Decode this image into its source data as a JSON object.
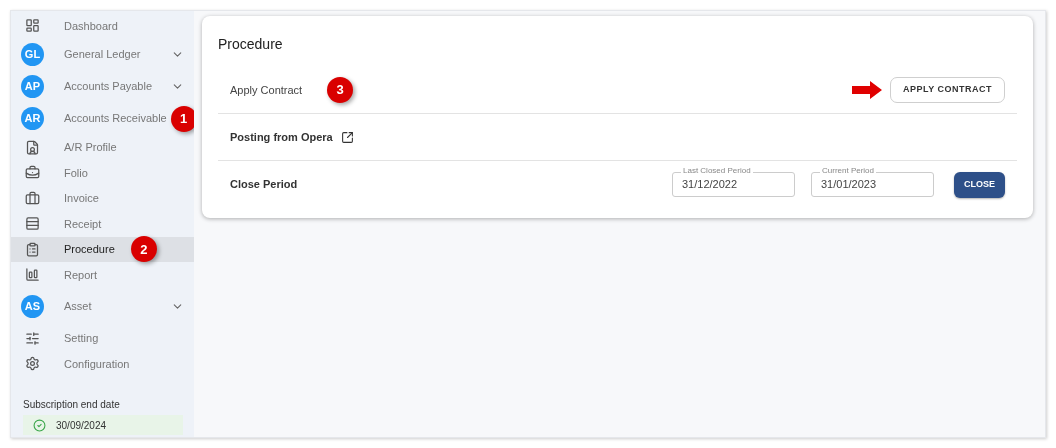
{
  "sidebar": {
    "items": [
      {
        "kind": "icon",
        "label": "Dashboard",
        "selected": false
      },
      {
        "kind": "avatar",
        "avatar": "GL",
        "label": "General Ledger",
        "expandable": true,
        "selected": false
      },
      {
        "kind": "avatar",
        "avatar": "AP",
        "label": "Accounts Payable",
        "expandable": true,
        "selected": false
      },
      {
        "kind": "avatar",
        "avatar": "AR",
        "label": "Accounts Receivable",
        "expandable": false,
        "selected": false,
        "marker": "1"
      },
      {
        "kind": "icon",
        "label": "A/R Profile",
        "selected": false
      },
      {
        "kind": "icon",
        "label": "Folio",
        "selected": false
      },
      {
        "kind": "icon",
        "label": "Invoice",
        "selected": false
      },
      {
        "kind": "icon",
        "label": "Receipt",
        "selected": false
      },
      {
        "kind": "icon",
        "label": "Procedure",
        "selected": true,
        "marker": "2"
      },
      {
        "kind": "icon",
        "label": "Report",
        "selected": false
      },
      {
        "kind": "avatar",
        "avatar": "AS",
        "label": "Asset",
        "expandable": true,
        "selected": false
      },
      {
        "kind": "icon",
        "label": "Setting",
        "selected": false
      },
      {
        "kind": "icon",
        "label": "Configuration",
        "selected": false
      }
    ],
    "subscription": {
      "label": "Subscription end date",
      "date": "30/09/2024"
    }
  },
  "card": {
    "title": "Procedure",
    "rows": [
      {
        "kind": "action",
        "label": "Apply Contract",
        "marker": "3",
        "button": "APPLY CONTRACT"
      },
      {
        "kind": "link",
        "label": "Posting from Opera"
      },
      {
        "kind": "period",
        "label": "Close Period",
        "fields": [
          {
            "label": "Last Closed Period",
            "value": "31/12/2022"
          },
          {
            "label": "Current Period",
            "value": "31/01/2023"
          }
        ],
        "button": "CLOSE"
      }
    ]
  }
}
